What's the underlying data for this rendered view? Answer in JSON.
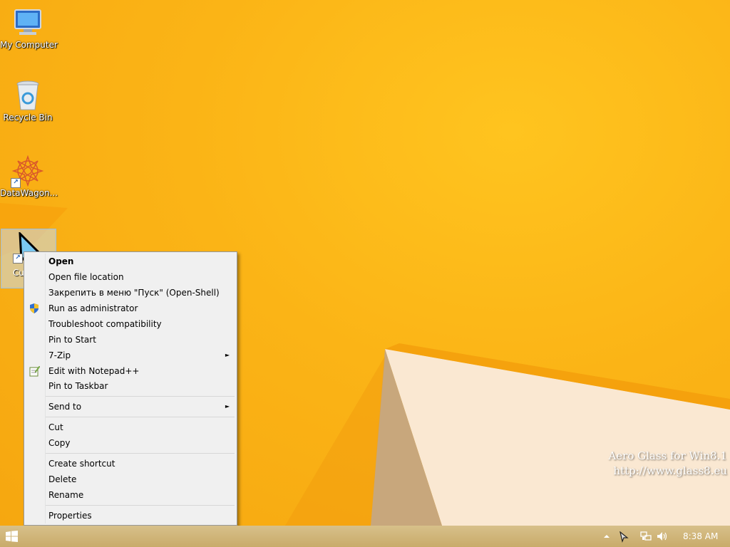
{
  "desktop": {
    "icons": [
      {
        "label": "My Computer",
        "icon": "computer-icon"
      },
      {
        "label": "Recycle Bin",
        "icon": "recycle-bin-icon"
      },
      {
        "label": "DataWagon...",
        "icon": "datawagon-icon"
      }
    ],
    "selected_icon_label": "Cu Cu",
    "watermark_line1": "Aero Glass for Win8.1",
    "watermark_line2": "http://www.glass8.eu"
  },
  "context_menu": {
    "items": [
      {
        "label": "Open",
        "bold": true
      },
      {
        "label": "Open file location"
      },
      {
        "label": "Закрепить в меню \"Пуск\" (Open-Shell)"
      },
      {
        "label": "Run as administrator",
        "icon": "shield-icon"
      },
      {
        "label": "Troubleshoot compatibility"
      },
      {
        "label": "Pin to Start"
      },
      {
        "label": "7-Zip",
        "submenu": true
      },
      {
        "label": "Edit with Notepad++",
        "icon": "notepad-plus-plus-icon"
      },
      {
        "label": "Pin to Taskbar"
      },
      {
        "label": "Send to",
        "submenu": true
      },
      {
        "label": "Cut"
      },
      {
        "label": "Copy"
      },
      {
        "label": "Create shortcut"
      },
      {
        "label": "Delete"
      },
      {
        "label": "Rename"
      },
      {
        "label": "Properties"
      }
    ],
    "submenu_arrow": "►"
  },
  "taskbar": {
    "start_icon": "windows-logo-icon",
    "tray_icons": [
      "chevron-up-icon",
      "cursor-icon",
      "network-icon",
      "volume-icon"
    ],
    "clock": "8:38 AM"
  },
  "colors": {
    "wallpaper": "#f9b310",
    "menu_background": "#f0f0f0"
  }
}
